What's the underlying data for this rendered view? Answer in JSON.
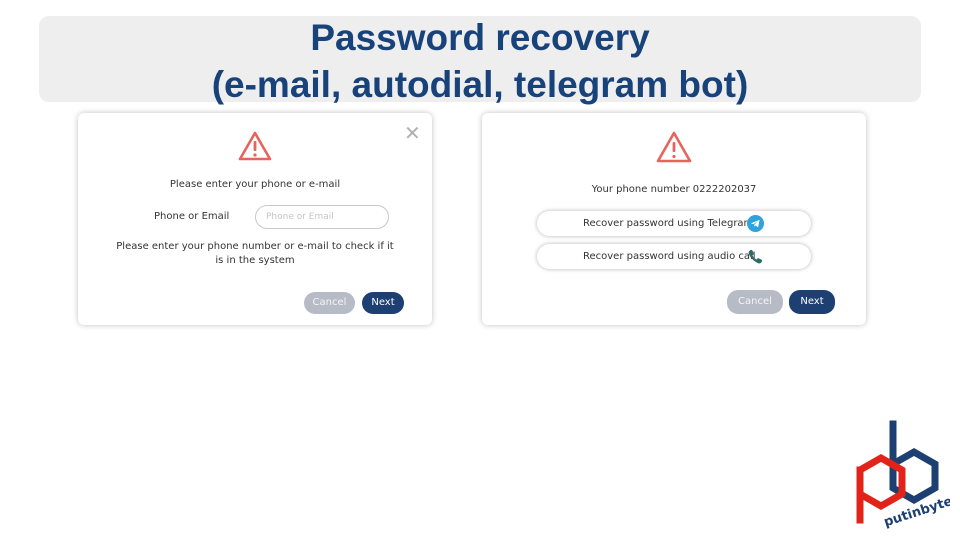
{
  "title": {
    "line1": "Password recovery",
    "line2": "(e-mail, autodial, telegram bot)"
  },
  "left_dialog": {
    "prompt": "Please enter your phone or e-mail",
    "field_label": "Phone or Email",
    "input_placeholder": "Phone or Email",
    "input_value": "",
    "help_line1": "Please enter your phone number or e-mail to check if it",
    "help_line2": "is in the system",
    "cancel_label": "Cancel",
    "next_label": "Next",
    "icons": [
      "warning-icon",
      "close-icon"
    ]
  },
  "right_dialog": {
    "phone_text": "Your phone number 0222202037",
    "telegram_option": "Recover password using Telegram",
    "audio_option": "Recover password using audio call",
    "cancel_label": "Cancel",
    "next_label": "Next",
    "icons": [
      "warning-icon",
      "telegram-icon",
      "phone-icon"
    ]
  },
  "logo": {
    "text": "putinbyte"
  },
  "colors": {
    "title": "#17427a",
    "banner": "#eeeeee",
    "warning": "#e8635c",
    "next_button": "#1d3f72",
    "cancel_button": "#b7bbc5",
    "telegram": "#2ea3dc",
    "phone": "#2f6b6b",
    "logo_red": "#e2231a",
    "logo_blue": "#1d3f72"
  }
}
